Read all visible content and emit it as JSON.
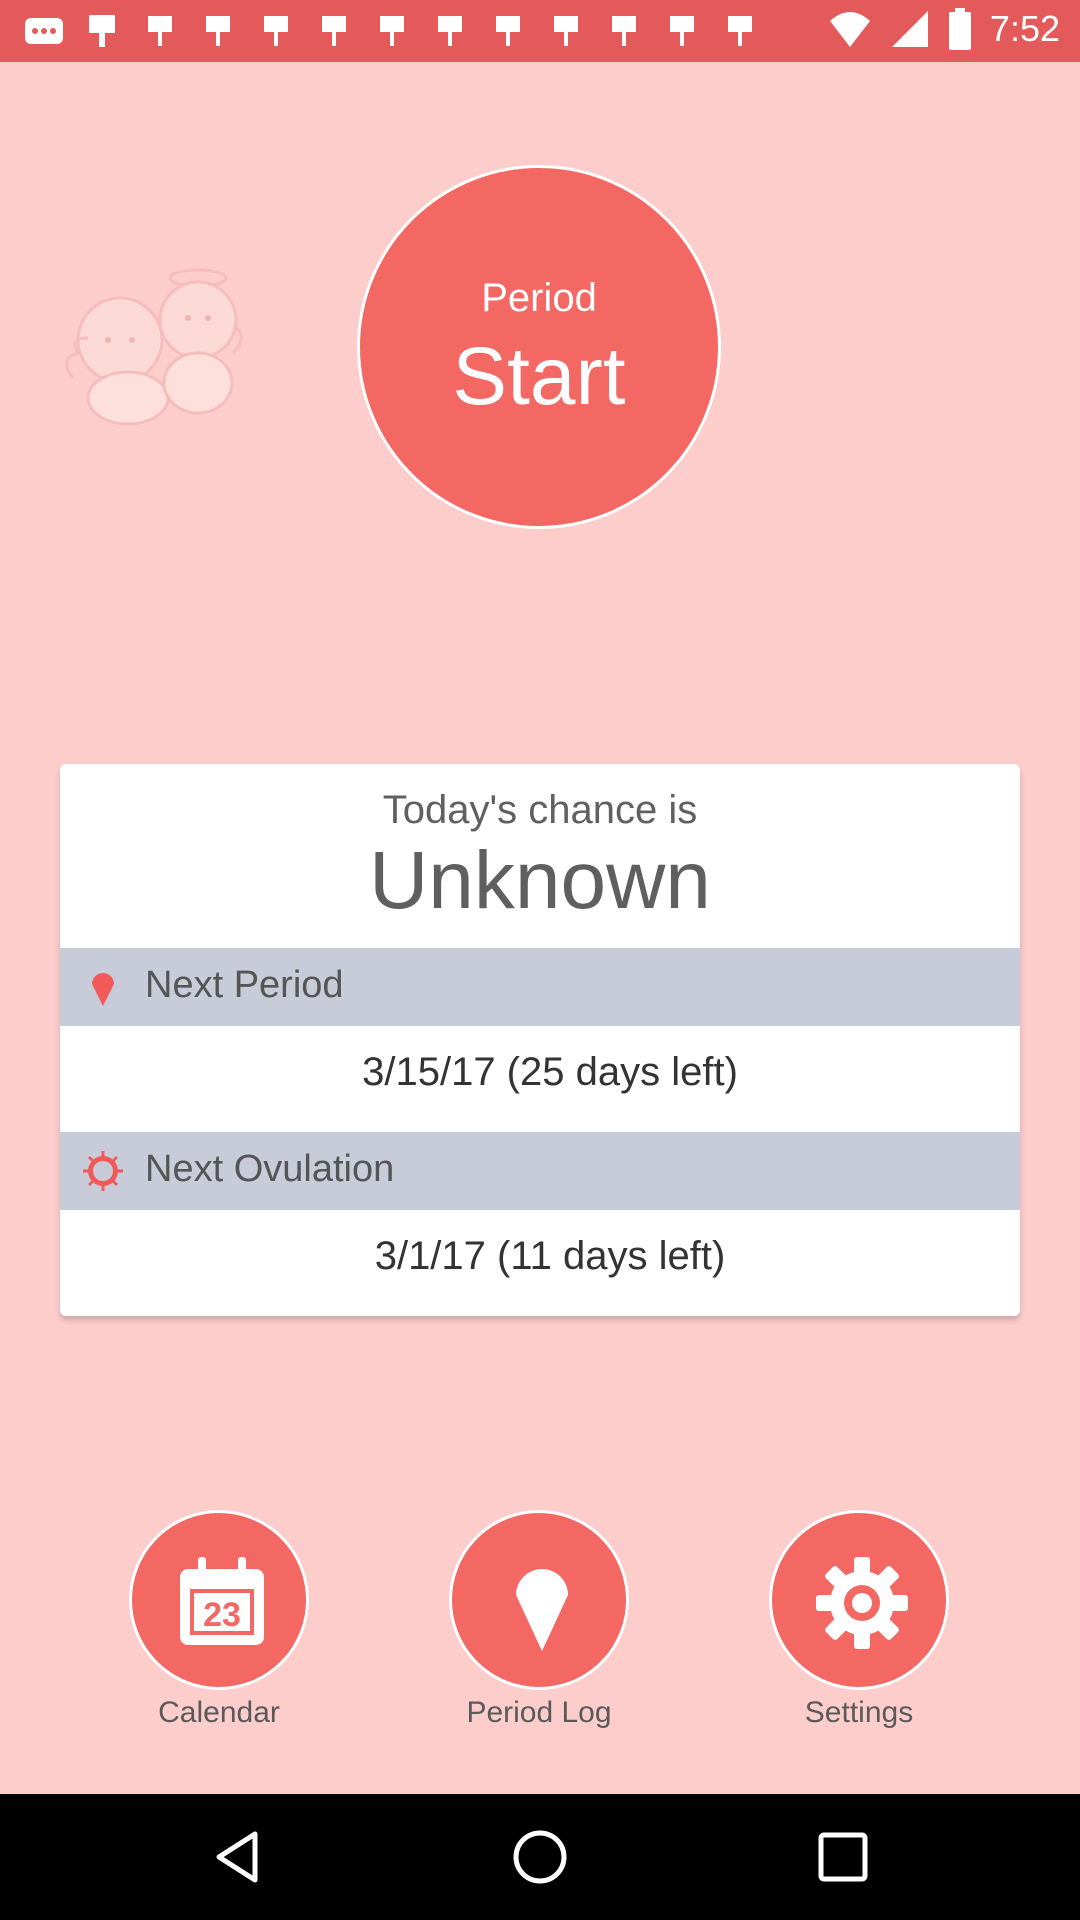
{
  "status_bar": {
    "time": "7:52",
    "notification_icons": [
      "more-icon",
      "flag-icon",
      "flag-icon",
      "flag-icon",
      "flag-icon",
      "flag-icon",
      "flag-icon",
      "flag-icon",
      "flag-icon",
      "flag-icon",
      "flag-icon",
      "flag-icon",
      "flag-icon"
    ],
    "system_icons": [
      "wifi-icon",
      "signal-icon",
      "battery-icon"
    ],
    "color": "#e45a5a"
  },
  "start_button": {
    "small_label": "Period",
    "big_label": "Start",
    "color": "#f46864"
  },
  "card": {
    "chance_label": "Today's chance is",
    "chance_value": "Unknown",
    "next_period": {
      "label": "Next Period",
      "value": "3/15/17 (25 days left)",
      "icon": "pin-icon"
    },
    "next_ovulation": {
      "label": "Next Ovulation",
      "value": "3/1/17 (11 days left)",
      "icon": "sun-icon"
    }
  },
  "bottom_nav": [
    {
      "label": "Calendar",
      "icon": "calendar-icon",
      "calendar_day": "23"
    },
    {
      "label": "Period Log",
      "icon": "pin-icon"
    },
    {
      "label": "Settings",
      "icon": "gear-icon"
    }
  ],
  "colors": {
    "background": "#fdcdcc",
    "accent": "#f46864",
    "section_header": "#c8cbd8"
  }
}
